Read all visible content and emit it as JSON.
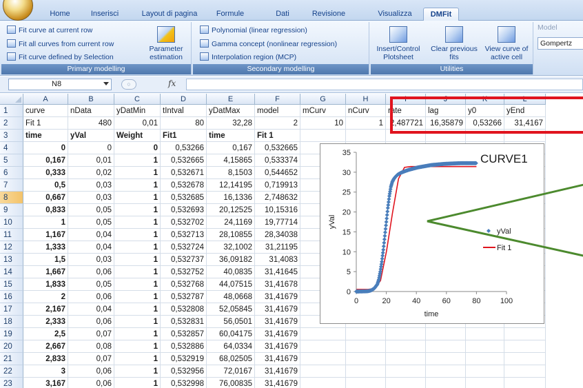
{
  "ribbon": {
    "tabs": [
      "Home",
      "Inserisci",
      "Layout di pagina",
      "Formule",
      "Dati",
      "Revisione",
      "Visualizza",
      "DMFit"
    ],
    "active_tab": "DMFit",
    "primary": {
      "label": "Primary modelling",
      "items": [
        "Fit curve at current row",
        "Fit all curves from current row",
        "Fit curve defined by Selection"
      ],
      "param_btn": "Parameter estimation"
    },
    "secondary": {
      "label": "Secondary modelling",
      "items": [
        "Polynomial (linear regression)",
        "Gamma concept (nonlinear regression)",
        "Interpolation region (MCP)"
      ]
    },
    "utilities": {
      "label": "Utilities",
      "buttons": [
        "Insert/Control Plotsheet",
        "Clear previous fits",
        "View curve of active cell"
      ]
    },
    "model": {
      "label": "Model",
      "value": "Gompertz"
    }
  },
  "formula_bar": {
    "namebox": "N8",
    "fx": "fx",
    "formula": ""
  },
  "grid": {
    "columns": [
      "A",
      "B",
      "C",
      "D",
      "E",
      "F",
      "G",
      "H",
      "I",
      "J",
      "K",
      "L"
    ],
    "rows": [
      [
        "curve",
        "nData",
        "yDatMin",
        "tIntval",
        "yDatMax",
        "model",
        "mCurv",
        "nCurv",
        "rate",
        "lag",
        "y0",
        "yEnd"
      ],
      [
        "Fit 1",
        "480",
        "0,01",
        "80",
        "32,28",
        "2",
        "10",
        "1",
        "2,487721",
        "16,35879",
        "0,53266",
        "31,4167"
      ],
      [
        "time",
        "yVal",
        "Weight",
        "Fit1",
        "time",
        "Fit 1",
        "",
        "",
        "",
        "",
        "",
        ""
      ],
      [
        "0",
        "0",
        "0",
        "0,53266",
        "0,167",
        "0,532665",
        "",
        "",
        "",
        "",
        "",
        ""
      ],
      [
        "0,167",
        "0,01",
        "1",
        "0,532665",
        "4,15865",
        "0,533374",
        "",
        "",
        "",
        "",
        "",
        ""
      ],
      [
        "0,333",
        "0,02",
        "1",
        "0,532671",
        "8,1503",
        "0,544652",
        "",
        "",
        "",
        "",
        "",
        ""
      ],
      [
        "0,5",
        "0,03",
        "1",
        "0,532678",
        "12,14195",
        "0,719913",
        "",
        "",
        "",
        "",
        "",
        ""
      ],
      [
        "0,667",
        "0,03",
        "1",
        "0,532685",
        "16,1336",
        "2,748632",
        "",
        "",
        "",
        "",
        "",
        ""
      ],
      [
        "0,833",
        "0,05",
        "1",
        "0,532693",
        "20,12525",
        "10,15316",
        "",
        "",
        "",
        "",
        "",
        ""
      ],
      [
        "1",
        "0,05",
        "1",
        "0,532702",
        "24,1169",
        "19,77714",
        "",
        "",
        "",
        "",
        "",
        ""
      ],
      [
        "1,167",
        "0,04",
        "1",
        "0,532713",
        "28,10855",
        "28,34038",
        "",
        "",
        "",
        "",
        "",
        ""
      ],
      [
        "1,333",
        "0,04",
        "1",
        "0,532724",
        "32,1002",
        "31,21195",
        "",
        "",
        "",
        "",
        "",
        ""
      ],
      [
        "1,5",
        "0,03",
        "1",
        "0,532737",
        "36,09182",
        "31,4083",
        "",
        "",
        "",
        "",
        "",
        ""
      ],
      [
        "1,667",
        "0,06",
        "1",
        "0,532752",
        "40,0835",
        "31,41645",
        "",
        "",
        "",
        "",
        "",
        ""
      ],
      [
        "1,833",
        "0,05",
        "1",
        "0,532768",
        "44,07515",
        "31,41678",
        "",
        "",
        "",
        "",
        "",
        ""
      ],
      [
        "2",
        "0,06",
        "1",
        "0,532787",
        "48,0668",
        "31,41679",
        "",
        "",
        "",
        "",
        "",
        ""
      ],
      [
        "2,167",
        "0,04",
        "1",
        "0,532808",
        "52,05845",
        "31,41679",
        "",
        "",
        "",
        "",
        "",
        ""
      ],
      [
        "2,333",
        "0,06",
        "1",
        "0,532831",
        "56,0501",
        "31,41679",
        "",
        "",
        "",
        "",
        "",
        ""
      ],
      [
        "2,5",
        "0,07",
        "1",
        "0,532857",
        "60,04175",
        "31,41679",
        "",
        "",
        "",
        "",
        "",
        ""
      ],
      [
        "2,667",
        "0,08",
        "1",
        "0,532886",
        "64,0334",
        "31,41679",
        "",
        "",
        "",
        "",
        "",
        ""
      ],
      [
        "2,833",
        "0,07",
        "1",
        "0,532919",
        "68,02505",
        "31,41679",
        "",
        "",
        "",
        "",
        "",
        ""
      ],
      [
        "3",
        "0,06",
        "1",
        "0,532956",
        "72,0167",
        "31,41679",
        "",
        "",
        "",
        "",
        "",
        ""
      ],
      [
        "3,167",
        "0,06",
        "1",
        "0,532998",
        "76,00835",
        "31,41679",
        "",
        "",
        "",
        "",
        "",
        ""
      ]
    ],
    "selected_row": 8,
    "highlight_color": "#e0141e"
  },
  "chart_data": {
    "type": "scatter",
    "title": "CURVE1",
    "xlabel": "time",
    "ylabel": "yVal",
    "xlim": [
      0,
      100
    ],
    "ylim": [
      0,
      35
    ],
    "xticks": [
      "0",
      "20",
      "40",
      "60",
      "80",
      "100"
    ],
    "yticks": [
      "0",
      "5",
      "10",
      "15",
      "20",
      "25",
      "30",
      "35"
    ],
    "legend": "right",
    "series": [
      {
        "name": "yVal",
        "kind": "markers",
        "color": "#4a7ebb",
        "points": [
          [
            0,
            0
          ],
          [
            3,
            0.02
          ],
          [
            6,
            0.05
          ],
          [
            8,
            0.1
          ],
          [
            10,
            0.3
          ],
          [
            12,
            0.8
          ],
          [
            14,
            1.8
          ],
          [
            15,
            3
          ],
          [
            16,
            5
          ],
          [
            17,
            7.5
          ],
          [
            18,
            10.5
          ],
          [
            19,
            14
          ],
          [
            20,
            17.5
          ],
          [
            21,
            21
          ],
          [
            22,
            24
          ],
          [
            23,
            26.3
          ],
          [
            24,
            27.6
          ],
          [
            25,
            28.3
          ],
          [
            26,
            28.8
          ],
          [
            27,
            29.2
          ],
          [
            28,
            29.5
          ],
          [
            30,
            29.9
          ],
          [
            32,
            30.2
          ],
          [
            35,
            30.6
          ],
          [
            38,
            30.9
          ],
          [
            41,
            31.2
          ],
          [
            44,
            31.4
          ],
          [
            47,
            31.6
          ],
          [
            50,
            31.8
          ],
          [
            53,
            31.9
          ],
          [
            56,
            32.0
          ],
          [
            59,
            32.1
          ],
          [
            62,
            32.15
          ],
          [
            65,
            32.2
          ],
          [
            68,
            32.25
          ],
          [
            71,
            32.28
          ],
          [
            74,
            32.28
          ],
          [
            77,
            32.28
          ],
          [
            80,
            32.28
          ]
        ]
      },
      {
        "name": "Fit 1",
        "kind": "line",
        "color": "#e0141e",
        "points": [
          [
            0.167,
            0.532665
          ],
          [
            4.15865,
            0.533374
          ],
          [
            8.1503,
            0.544652
          ],
          [
            12.14195,
            0.719913
          ],
          [
            16.1336,
            2.748632
          ],
          [
            20.12525,
            10.15316
          ],
          [
            24.1169,
            19.77714
          ],
          [
            28.10855,
            28.34038
          ],
          [
            32.1002,
            31.21195
          ],
          [
            36.09182,
            31.4083
          ],
          [
            40.0835,
            31.41645
          ],
          [
            44.07515,
            31.41678
          ],
          [
            48.0668,
            31.41679
          ],
          [
            52.05845,
            31.41679
          ],
          [
            56.0501,
            31.41679
          ],
          [
            60.04175,
            31.41679
          ],
          [
            64.0334,
            31.41679
          ],
          [
            68.02505,
            31.41679
          ],
          [
            72.0167,
            31.41679
          ],
          [
            76.00835,
            31.41679
          ],
          [
            80,
            31.41679
          ]
        ]
      }
    ]
  },
  "colors": {
    "frame": "#2f6b1f",
    "callout": "#4c8a2e",
    "ribbon_label": "#4f78ad"
  }
}
